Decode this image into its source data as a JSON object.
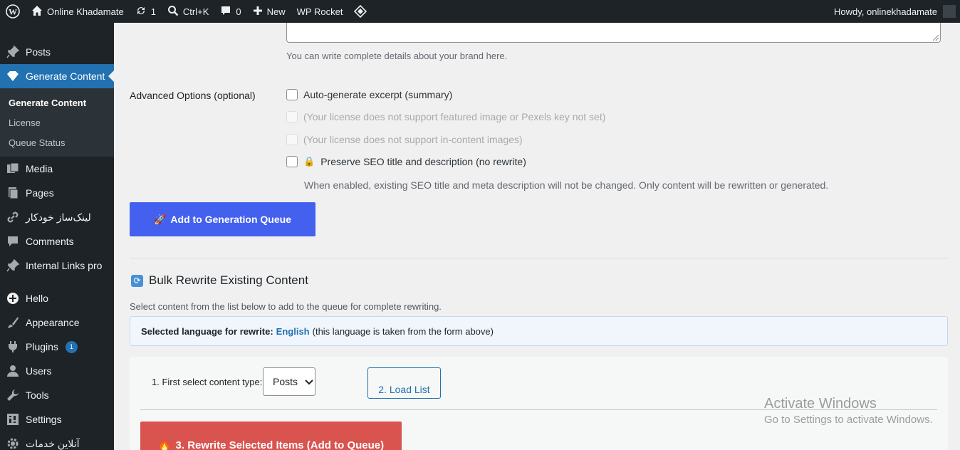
{
  "adminbar": {
    "site_name": "Online Khadamate",
    "updates_count": "1",
    "search_shortcut": "Ctrl+K",
    "comments_count": "0",
    "new_label": "New",
    "wp_rocket_label": "WP Rocket",
    "howdy": "Howdy, onlinekhadamate"
  },
  "sidebar": {
    "items": [
      {
        "label": "Posts",
        "icon": "pin-icon"
      },
      {
        "label": "Generate Content",
        "icon": "diamond-icon"
      },
      {
        "label": "Media",
        "icon": "media-icon"
      },
      {
        "label": "Pages",
        "icon": "pages-icon"
      },
      {
        "label": "لینک‌ساز خودکار",
        "icon": "link-icon"
      },
      {
        "label": "Comments",
        "icon": "comment-icon"
      },
      {
        "label": "Internal Links pro",
        "icon": "pin-icon"
      },
      {
        "label": "Hello",
        "icon": "plus-circle-icon"
      },
      {
        "label": "Appearance",
        "icon": "brush-icon"
      },
      {
        "label": "Plugins",
        "icon": "plug-icon",
        "badge": "1"
      },
      {
        "label": "Users",
        "icon": "user-icon"
      },
      {
        "label": "Tools",
        "icon": "wrench-icon"
      },
      {
        "label": "Settings",
        "icon": "settings-icon"
      },
      {
        "label": "آنلاین خدمات",
        "icon": "gear-icon"
      }
    ],
    "submenu": [
      "Generate Content",
      "License",
      "Queue Status"
    ]
  },
  "form": {
    "brand_hint": "You can write complete details about your brand here.",
    "advanced_label": "Advanced Options (optional)",
    "options": [
      "Auto-generate excerpt (summary)",
      "(Your license does not support featured image or Pexels key not set)",
      "(Your license does not support in-content images)",
      "Preserve SEO title and description (no rewrite)"
    ],
    "seo_hint": "When enabled, existing SEO title and meta description will not be changed. Only content will be rewritten or generated.",
    "add_queue_button": "Add to Generation Queue"
  },
  "bulk": {
    "title": "Bulk Rewrite Existing Content",
    "description": "Select content from the list below to add to the queue for complete rewriting.",
    "lang_prefix": "Selected language for rewrite:",
    "lang_value": "English",
    "lang_suffix": "(this language is taken from the form above)",
    "select_label": "1. First select content type:",
    "select_value": "Posts",
    "load_button": "2. Load List",
    "rewrite_button": "3. Rewrite Selected Items (Add to Queue)"
  },
  "watermark": {
    "line1": "Activate Windows",
    "line2": "Go to Settings to activate Windows."
  },
  "colors": {
    "primary_button": "#4361ee",
    "rewrite_button": "#d9534f",
    "admin_dark": "#1d2327",
    "wp_blue": "#2271b1"
  }
}
